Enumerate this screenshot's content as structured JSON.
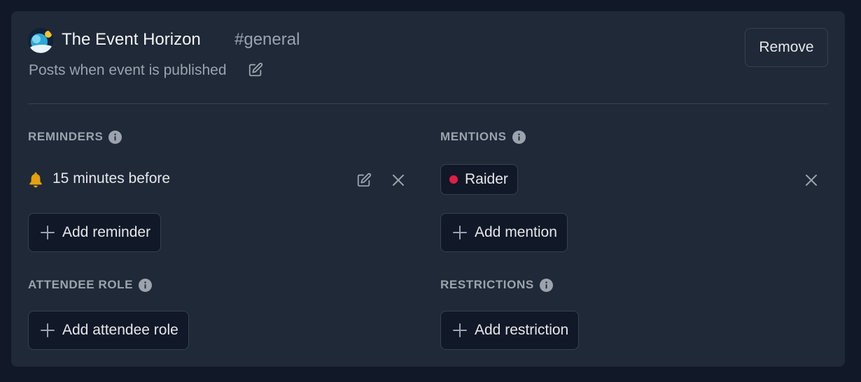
{
  "header": {
    "server_name": "The Event Horizon",
    "channel_name": "#general",
    "subtitle": "Posts when event is published",
    "remove_label": "Remove"
  },
  "reminders": {
    "title": "REMINDERS",
    "items": [
      {
        "label": "15 minutes before"
      }
    ],
    "add_label": "Add reminder"
  },
  "mentions": {
    "title": "MENTIONS",
    "items": [
      {
        "label": "Raider",
        "color": "#e11d48"
      }
    ],
    "add_label": "Add mention"
  },
  "attendee_role": {
    "title": "ATTENDEE ROLE",
    "add_label": "Add attendee role"
  },
  "restrictions": {
    "title": "RESTRICTIONS",
    "add_label": "Add restriction"
  },
  "colors": {
    "background": "#111827",
    "card": "#1f2937",
    "border": "#374151",
    "muted": "#9ca3af",
    "text": "#e5e7eb",
    "bell": "#e5a00d"
  },
  "icons": {
    "server_avatar": "server-avatar",
    "subtitle_edit": "edit-icon",
    "info": "info-icon",
    "bell": "bell-icon",
    "edit": "edit-icon",
    "close": "close-icon",
    "plus": "plus-icon"
  }
}
